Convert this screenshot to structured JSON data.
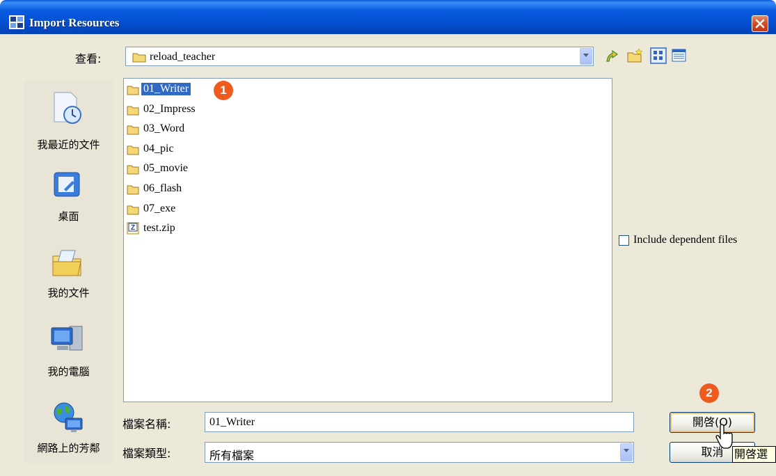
{
  "window": {
    "title": "Import Resources"
  },
  "lookin": {
    "label": "查看:",
    "value": "reload_teacher"
  },
  "places": [
    {
      "label": "我最近的文件",
      "icon": "recent-documents-icon"
    },
    {
      "label": "桌面",
      "icon": "desktop-icon"
    },
    {
      "label": "我的文件",
      "icon": "my-documents-icon"
    },
    {
      "label": "我的電腦",
      "icon": "my-computer-icon"
    },
    {
      "label": "網路上的芳鄰",
      "icon": "network-places-icon"
    }
  ],
  "files": [
    {
      "name": "01_Writer",
      "type": "folder",
      "selected": true
    },
    {
      "name": "02_Impress",
      "type": "folder"
    },
    {
      "name": "03_Word",
      "type": "folder"
    },
    {
      "name": "04_pic",
      "type": "folder"
    },
    {
      "name": "05_movie",
      "type": "folder"
    },
    {
      "name": "06_flash",
      "type": "folder"
    },
    {
      "name": "07_exe",
      "type": "folder"
    },
    {
      "name": "test.zip",
      "type": "zip"
    }
  ],
  "options": {
    "include_dependent_label": "Include dependent files",
    "include_dependent_checked": false
  },
  "filename": {
    "label": "檔案名稱:",
    "value": "01_Writer"
  },
  "filetype": {
    "label": "檔案類型:",
    "value": "所有檔案"
  },
  "buttons": {
    "open": "開啓(O)",
    "cancel": "取消"
  },
  "tooltip": "開啓選",
  "badges": {
    "one": "1",
    "two": "2"
  },
  "colors": {
    "titlebar": "#0a5ce0",
    "selection": "#316ac5",
    "badge": "#ef5a1e"
  }
}
